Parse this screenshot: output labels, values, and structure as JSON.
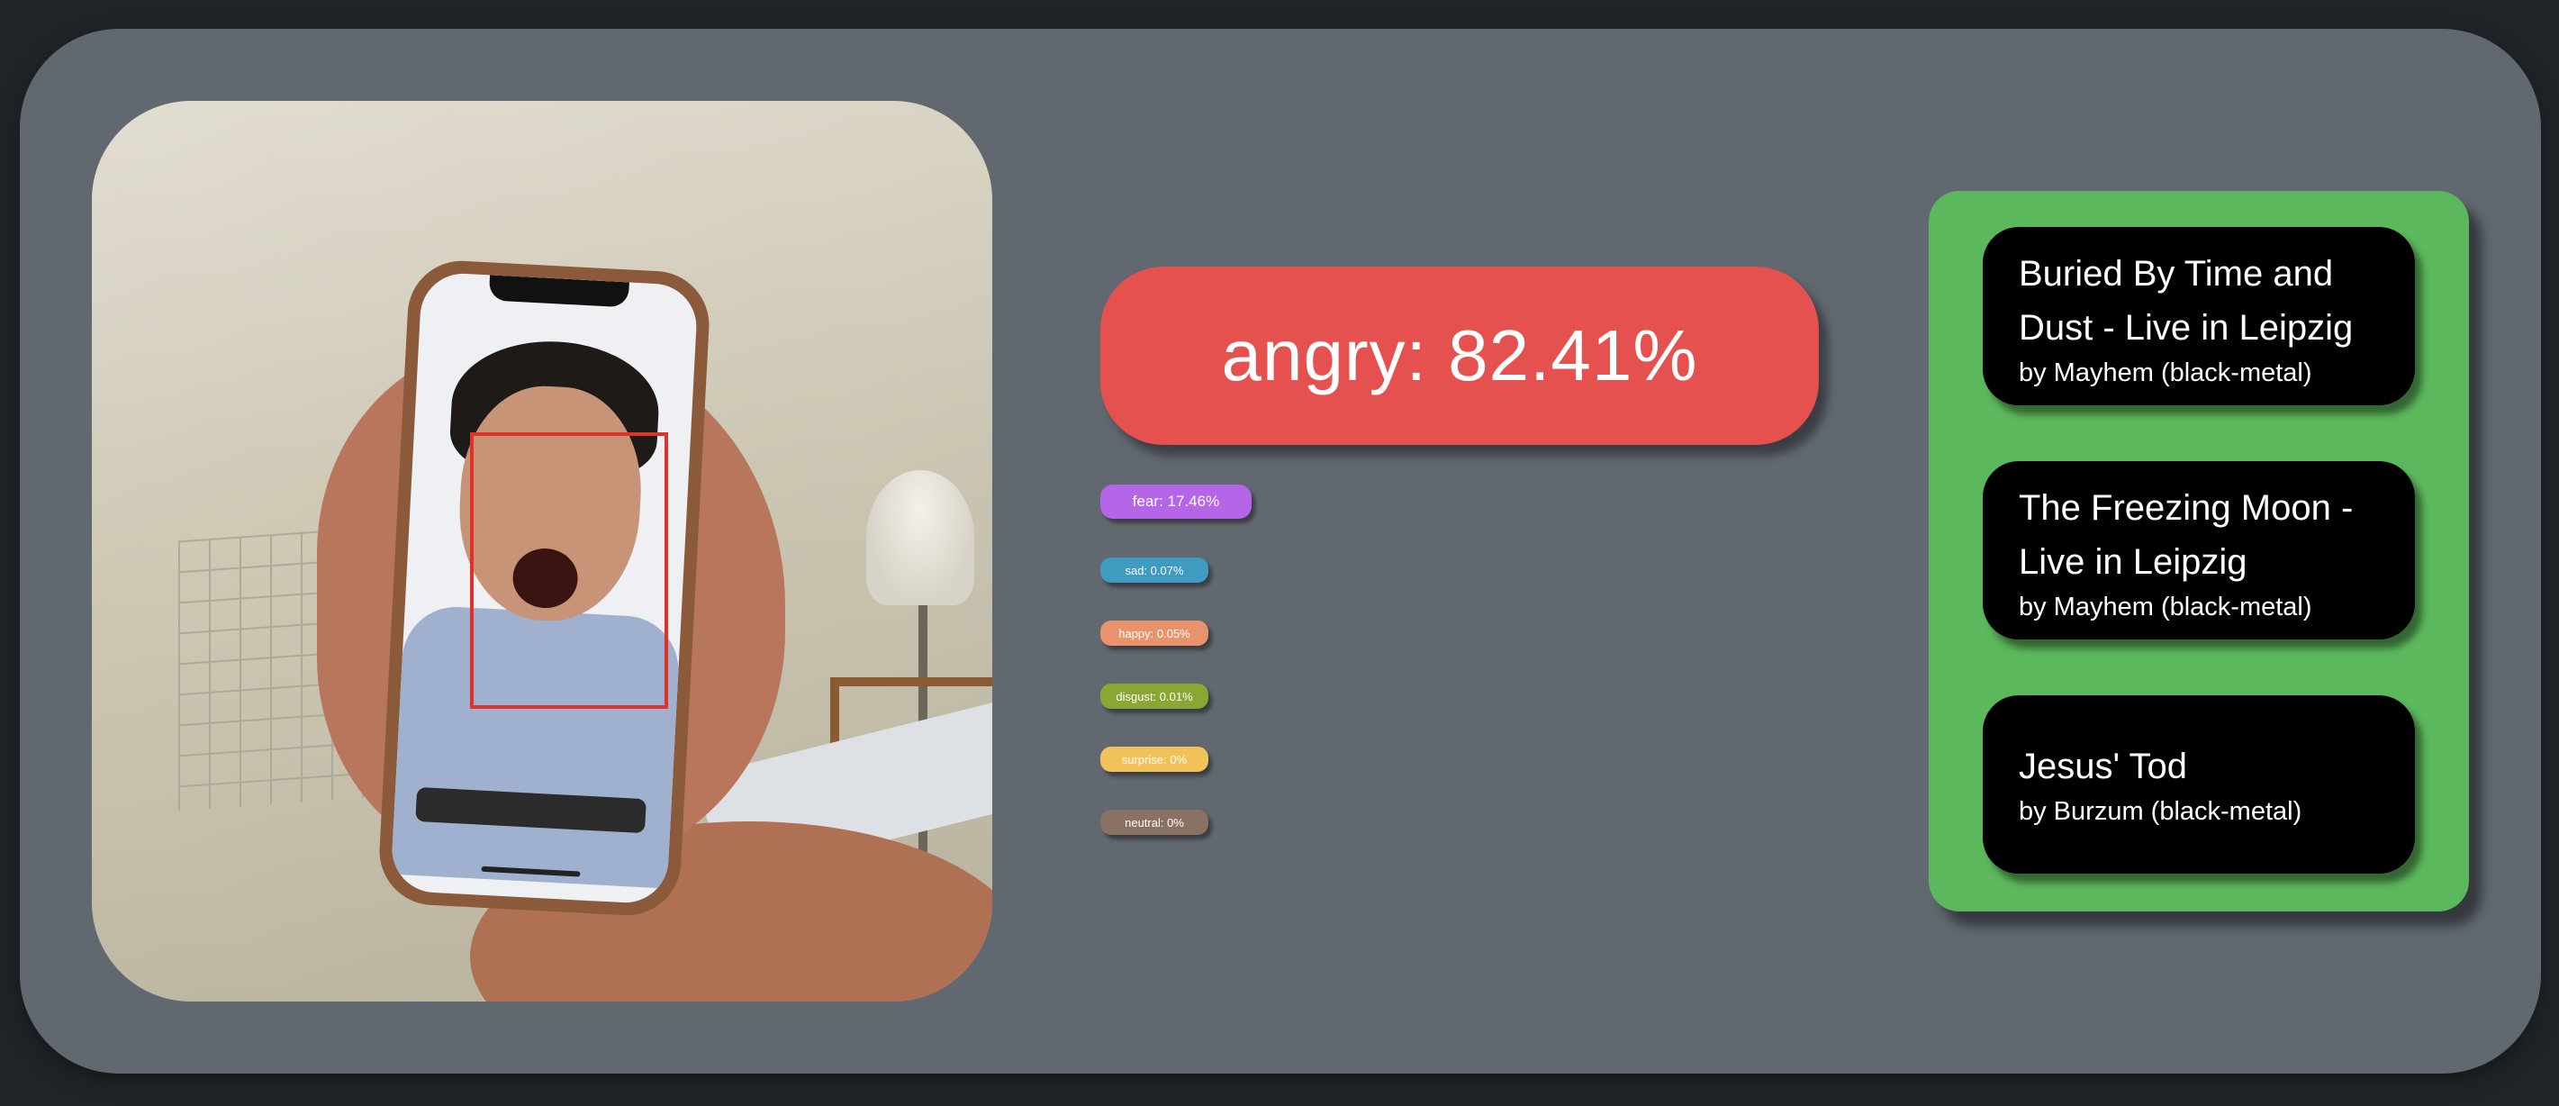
{
  "top_emotion": {
    "label": "angry: 82.41%",
    "color": "#e5514e"
  },
  "emotions": [
    {
      "label": "fear: 17.46%",
      "color": "#b566e6"
    },
    {
      "label": "sad: 0.07%",
      "color": "#3f9bbf"
    },
    {
      "label": "happy: 0.05%",
      "color": "#e8936b"
    },
    {
      "label": "disgust: 0.01%",
      "color": "#8ba632"
    },
    {
      "label": "surprise: 0%",
      "color": "#f1c25a"
    },
    {
      "label": "neutral: 0%",
      "color": "#8a7263"
    }
  ],
  "recommendations": {
    "panel_color": "#5cb85c",
    "songs": [
      {
        "title": "Buried By Time and Dust - Live in Leipzig",
        "artist": "by Mayhem (black-metal)"
      },
      {
        "title": "The Freezing Moon - Live in Leipzig",
        "artist": "by Mayhem (black-metal)"
      },
      {
        "title": "Jesus' Tod",
        "artist": "by Burzum (black-metal)"
      }
    ]
  },
  "camera": {
    "face_box_color": "#e0322a"
  }
}
